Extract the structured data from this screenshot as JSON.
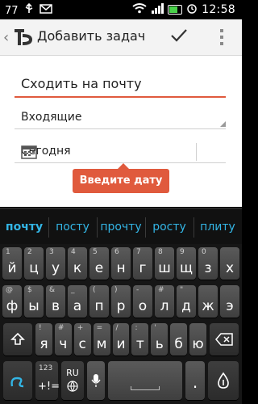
{
  "status": {
    "notification_count": "77",
    "time": "12:58",
    "colors": {
      "battery": "#49d14a"
    },
    "icons": [
      "usb-icon",
      "mail-icon",
      "wifi-icon",
      "signal-icon",
      "battery-icon",
      "alarm-icon"
    ]
  },
  "actionbar": {
    "title": "Добавить задач",
    "icons": [
      "back-icon",
      "app-logo-icon",
      "checkmark-icon",
      "overflow-menu-icon"
    ]
  },
  "form": {
    "task_title_value": "Сходить на почту",
    "list_value": "Входящие",
    "date_value": "Сегодня",
    "date_tooltip": "Введите дату",
    "colors": {
      "accent": "#e05a3d"
    }
  },
  "suggestions": [
    "почту",
    "посту",
    "прочту",
    "росту",
    "плиту"
  ],
  "keyboard": {
    "row1": [
      {
        "k": "й",
        "a": "1"
      },
      {
        "k": "ц",
        "a": "2"
      },
      {
        "k": "у",
        "a": "3"
      },
      {
        "k": "к",
        "a": "4"
      },
      {
        "k": "е",
        "a": "5"
      },
      {
        "k": "н",
        "a": "6"
      },
      {
        "k": "г",
        "a": "7"
      },
      {
        "k": "ш",
        "a": "8"
      },
      {
        "k": "щ",
        "a": "9"
      },
      {
        "k": "з",
        "a": "0"
      },
      {
        "k": "х",
        "a": ""
      }
    ],
    "row2": [
      {
        "k": "ф",
        "a": "@"
      },
      {
        "k": "ы",
        "a": "$"
      },
      {
        "k": "в",
        "a": "&"
      },
      {
        "k": "а",
        "a": "_"
      },
      {
        "k": "п",
        "a": "("
      },
      {
        "k": "р",
        "a": ")"
      },
      {
        "k": "о",
        "a": "-"
      },
      {
        "k": "л",
        "a": "#"
      },
      {
        "k": "д",
        "a": "\""
      },
      {
        "k": "ж",
        "a": ""
      },
      {
        "k": "э",
        "a": ""
      }
    ],
    "row3": [
      {
        "k": "я",
        "a": "!"
      },
      {
        "k": "ч",
        "a": "#"
      },
      {
        "k": "с",
        "a": "+"
      },
      {
        "k": "м",
        "a": "="
      },
      {
        "k": "и",
        "a": "/"
      },
      {
        "k": "т",
        "a": ":"
      },
      {
        "k": "ь",
        "a": "'"
      },
      {
        "k": "б",
        "a": ""
      },
      {
        "k": "ю",
        "a": ""
      }
    ],
    "symbols_top": "123",
    "symbols_bottom": "+!=",
    "lang_label": "RU",
    "icons": [
      "swype-icon",
      "shift-icon",
      "backspace-icon",
      "globe-icon",
      "microphone-icon",
      "space-bar",
      "period-key",
      "swype-drag-icon"
    ]
  }
}
